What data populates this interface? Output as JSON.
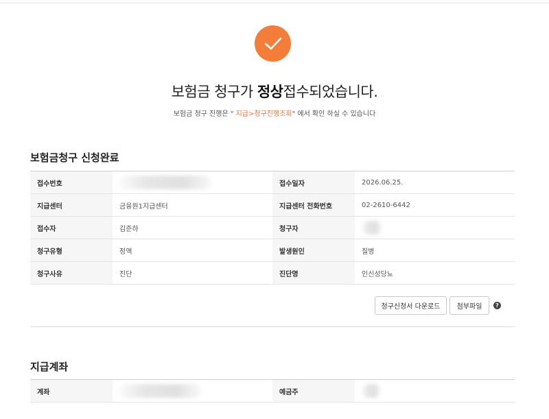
{
  "confirmation": {
    "headline_pre": "보험금 청구가 ",
    "headline_bold": "정상",
    "headline_post": "접수되었습니다.",
    "sub_pre": "보험금 청구 진행은 \" ",
    "sub_link": "지급>청구진행조회",
    "sub_post": "\" 에서 확인 하실 수 있습니다"
  },
  "claim_section": {
    "title": "보험금청구 신청완료",
    "rows": [
      {
        "label1": "접수번호",
        "value1": "",
        "label2": "접수일자",
        "value2": "2026.06.25."
      },
      {
        "label1": "지급센터",
        "value1": "금융원1지급센터",
        "label2": "지급센터 전화번호",
        "value2": "02-2610-6442"
      },
      {
        "label1": "접수자",
        "value1": "김준하",
        "label2": "청구자",
        "value2": ""
      },
      {
        "label1": "청구유형",
        "value1": "정액",
        "label2": "발생원인",
        "value2": "질병"
      },
      {
        "label1": "청구사유",
        "value1": "진단",
        "label2": "진단명",
        "value2": "인신성당뇨"
      }
    ],
    "download_button": "청구신청서 다운로드",
    "attach_button": "첨부파일",
    "help_icon": "question-mark-icon"
  },
  "account_section": {
    "title": "지급계좌",
    "label1": "계좌",
    "value1": "",
    "label2": "예금주",
    "value2": ""
  },
  "colors": {
    "accent": "#f47d3a",
    "link": "#e8743b"
  }
}
